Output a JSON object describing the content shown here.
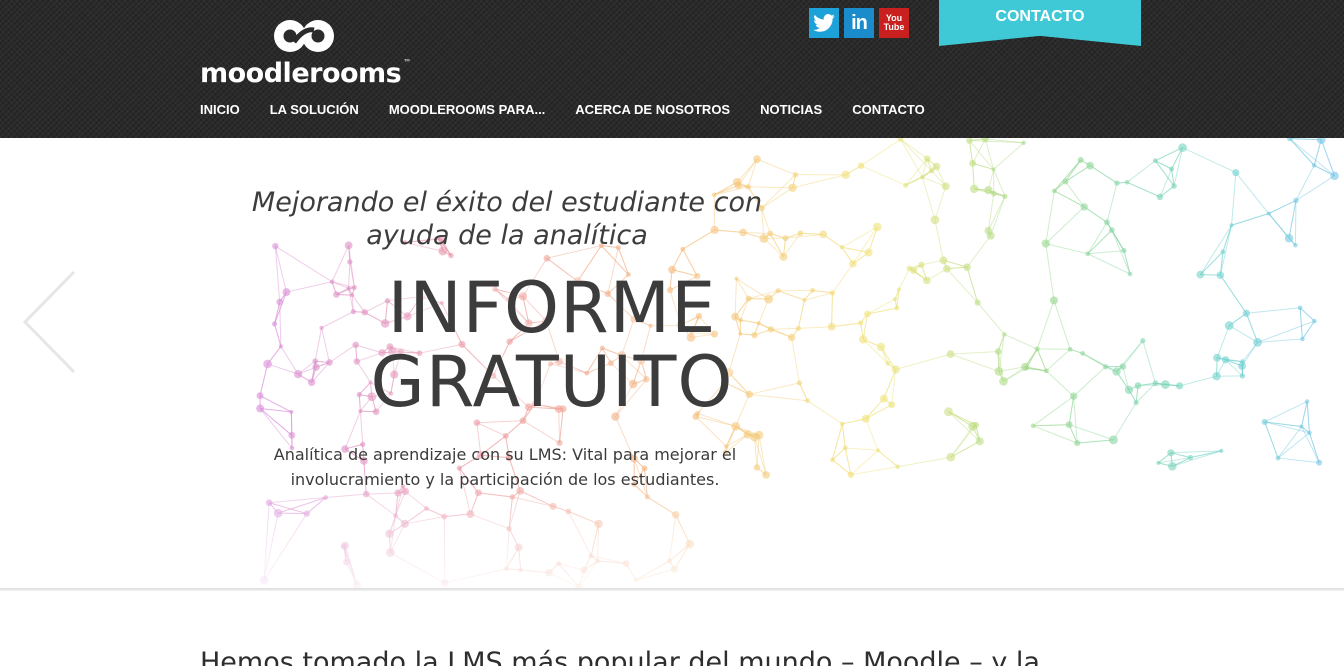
{
  "header": {
    "logo_text": "moodlerooms",
    "logo_tm": "™",
    "nav": [
      {
        "label": "INICIO"
      },
      {
        "label": "LA SOLUCIÓN"
      },
      {
        "label": "MOODLEROOMS PARA..."
      },
      {
        "label": "ACERCA DE NOSOTROS"
      },
      {
        "label": "NOTICIAS"
      },
      {
        "label": "CONTACTO"
      }
    ],
    "social": [
      {
        "icon": "twitter-icon"
      },
      {
        "icon": "linkedin-icon",
        "glyph": "in"
      },
      {
        "icon": "youtube-icon",
        "glyph_top": "You",
        "glyph_bottom": "Tube"
      }
    ],
    "contact_button": "CONTACTO"
  },
  "hero": {
    "tagline": "Mejorando el éxito del estudiante con ayuda de la analítica",
    "headline_line1": "INFORME",
    "headline_line2": "GRATUITO",
    "subcopy": "Analítica de aprendizaje con su LMS: Vital para mejorar el involucramiento y la participación de los estudiantes.",
    "prev_arrow_icon": "chevron-left-icon"
  },
  "intro": {
    "text": "Hemos tomado la LMS más popular del mundo – Moodle – y la"
  },
  "colors": {
    "header_bg": "#2b2b2b",
    "accent": "#3fc9d6",
    "twitter": "#1da1d9",
    "linkedin": "#1a8ccc",
    "youtube": "#c8201f",
    "text_dark": "#3c3c3c"
  }
}
